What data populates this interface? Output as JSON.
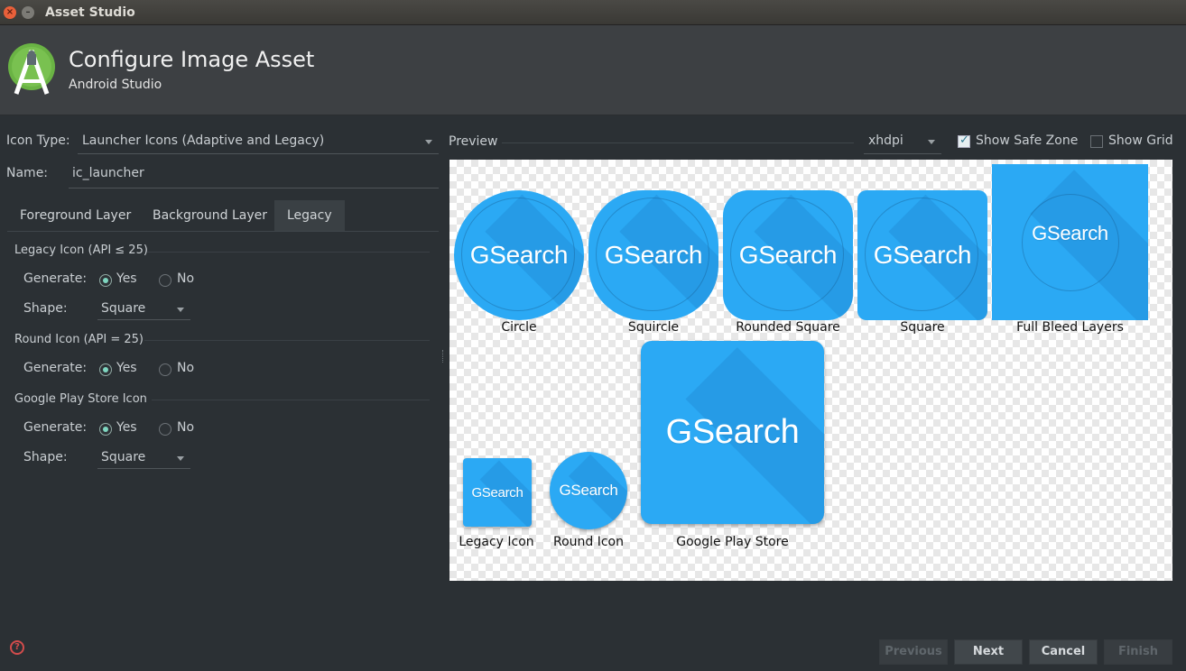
{
  "window": {
    "title": "Asset Studio",
    "close_glyph": "×",
    "min_glyph": "–"
  },
  "header": {
    "title": "Configure Image Asset",
    "subtitle": "Android Studio",
    "logo_icon": "android-studio-logo-icon"
  },
  "form": {
    "icon_type_label": "Icon Type:",
    "icon_type_value": "Launcher Icons (Adaptive and Legacy)",
    "name_label": "Name:",
    "name_value": "ic_launcher"
  },
  "tabs": [
    {
      "label": "Foreground Layer",
      "active": false
    },
    {
      "label": "Background Layer",
      "active": false
    },
    {
      "label": "Legacy",
      "active": true
    }
  ],
  "legacy": {
    "legacy_icon": {
      "title": "Legacy Icon (API ≤ 25)",
      "generate_label": "Generate:",
      "yes": "Yes",
      "no": "No",
      "shape_label": "Shape:",
      "shape_value": "Square"
    },
    "round_icon": {
      "title": "Round Icon (API = 25)",
      "generate_label": "Generate:",
      "yes": "Yes",
      "no": "No"
    },
    "play_store_icon": {
      "title": "Google Play Store Icon",
      "generate_label": "Generate:",
      "yes": "Yes",
      "no": "No",
      "shape_label": "Shape:",
      "shape_value": "Square"
    }
  },
  "preview": {
    "label": "Preview",
    "density": "xhdpi",
    "show_safe_zone": {
      "label": "Show Safe Zone",
      "checked": true
    },
    "show_grid": {
      "label": "Show Grid",
      "checked": false
    },
    "icon_text": "GSearch",
    "icon_color": "#2ba9f4",
    "captions": {
      "circle": "Circle",
      "squircle": "Squircle",
      "rounded_square": "Rounded Square",
      "square": "Square",
      "full_bleed": "Full Bleed Layers",
      "legacy": "Legacy Icon",
      "round": "Round Icon",
      "play_store": "Google Play Store"
    }
  },
  "buttons": {
    "previous": "Previous",
    "next": "Next",
    "cancel": "Cancel",
    "finish": "Finish",
    "help_glyph": "?"
  }
}
